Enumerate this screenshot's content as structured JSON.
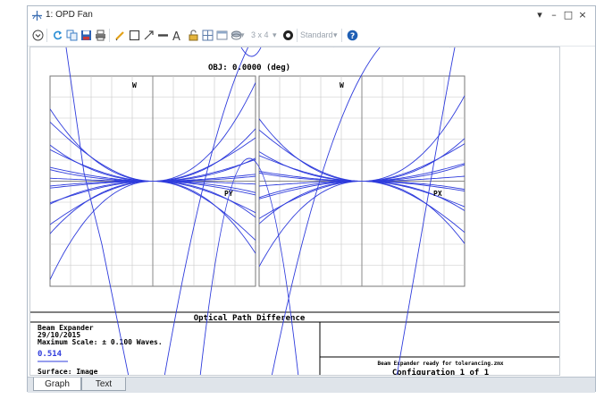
{
  "window": {
    "title": "1: OPD Fan",
    "controls": [
      "▾",
      "–",
      "□",
      "×"
    ]
  },
  "toolbar": {
    "layout_label": "3 x 4",
    "style_label": "Standard",
    "icons": [
      "settings-circle-icon",
      "refresh-icon",
      "copy-icon",
      "save-icon",
      "print-icon",
      "pencil-icon",
      "rectangle-icon",
      "arrow-icon",
      "line-icon",
      "text-icon",
      "lock-icon",
      "grid-icon",
      "window-icon",
      "layers-icon",
      "target-icon",
      "help-icon"
    ]
  },
  "plot": {
    "header": "OBJ: 0.0000 (deg)",
    "left_panel": {
      "axis_w": "W",
      "axis_p": "PY"
    },
    "right_panel": {
      "axis_w": "W",
      "axis_p": "PX"
    },
    "footer_title": "Optical Path Difference",
    "info": {
      "name": "Beam Expander",
      "date": "29/10/2015",
      "scale": "Maximum Scale: ± 0.100 Waves.",
      "wavelength": "0.514",
      "surface": "Surface: Image"
    },
    "file_note": "Beam Expander ready for tolerancing.zmx",
    "config": "Configuration 1 of 1",
    "colors": {
      "curve": "#2f3cdc",
      "grid": "#c8c8c8",
      "frame": "#7a7a7a"
    }
  },
  "tabs": [
    {
      "label": "Graph",
      "active": true
    },
    {
      "label": "Text",
      "active": false
    }
  ]
}
